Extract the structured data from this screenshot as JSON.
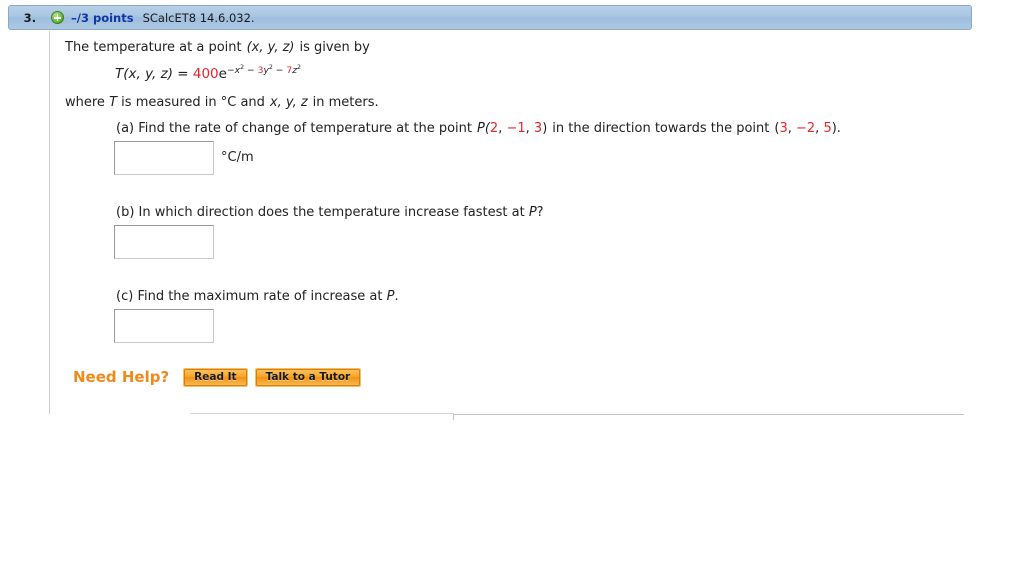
{
  "header": {
    "question_number": "3.",
    "expand_icon": "plus-circle-icon",
    "points": "–/3 points",
    "reference": "SCalcET8 14.6.032."
  },
  "problem": {
    "intro_prefix": "The temperature at a point",
    "intro_vars": "(x, y, z)",
    "intro_suffix": "is given by",
    "formula": {
      "lhs": "T(x, y, z)",
      "equals": "=",
      "coefficient": "400",
      "base": "e",
      "exp_term1": "−x",
      "exp_sup1": "2",
      "exp_op1": "−",
      "exp_coef2": "3",
      "exp_var2": "y",
      "exp_sup2": "2",
      "exp_op2": "−",
      "exp_coef3": "7",
      "exp_var3": "z",
      "exp_sup3": "2"
    },
    "units_line_a": "where",
    "units_line_b": "T",
    "units_line_c": "is measured in °C and",
    "units_line_d": "x, y, z",
    "units_line_e": "in meters."
  },
  "parts": [
    {
      "label": "(a)",
      "text_before_point": "Find the rate of change of temperature at the point",
      "point_name": "P(",
      "point_x": "2",
      "point_sep1": ", ",
      "point_y": "−1",
      "point_sep2": ", ",
      "point_z": "3",
      "point_close": ")",
      "text_middle": "in the direction towards the point",
      "dir_open": "(",
      "dir_x": "3",
      "dir_sep1": ", ",
      "dir_y": "−2",
      "dir_sep2": ", ",
      "dir_z": "5",
      "dir_close": ").",
      "answer_value": "",
      "answer_placeholder": "",
      "unit": "°C/m"
    },
    {
      "label": "(b)",
      "text": "In which direction does the temperature increase fastest at",
      "point_ref": "P",
      "text_end": "?",
      "answer_value": "",
      "answer_placeholder": ""
    },
    {
      "label": "(c)",
      "text": "Find the maximum rate of increase at",
      "point_ref": "P",
      "text_end": ".",
      "answer_value": "",
      "answer_placeholder": ""
    }
  ],
  "need_help": {
    "label": "Need Help?",
    "buttons": [
      {
        "label": "Read It"
      },
      {
        "label": "Talk to a Tutor"
      }
    ]
  },
  "colors": {
    "header_blue": "#a9c6e2",
    "points_blue": "#1036a8",
    "math_red": "#e8252a",
    "help_orange": "#f08a1c",
    "button_orange": "#ef9412"
  }
}
